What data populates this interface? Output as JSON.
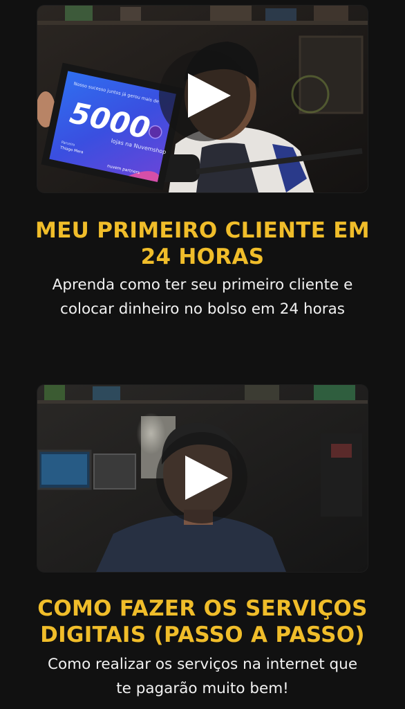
{
  "colors": {
    "background": "#111111",
    "title": "#f0bd2a",
    "description": "#f2f2f2"
  },
  "lessons": [
    {
      "title_line1": "MEU PRIMEIRO CLIENTE EM",
      "title_line2": "24 HORAS",
      "desc_line1": "Aprenda como ter seu primeiro cliente e",
      "desc_line2": "colocar dinheiro no bolso em 24 horas",
      "thumbnail": {
        "plaque_caption": "Nosso sucesso juntos já gerou mais de",
        "plaque_number": "5000",
        "plaque_subtitle": "lojas na Nuvemshop",
        "plaque_name_label": "Parceiro",
        "plaque_name": "Thiago Mera",
        "plaque_brand": "nuvem partners"
      },
      "play_icon": "play-icon"
    },
    {
      "title_line1": "COMO FAZER OS SERVIÇOS",
      "title_line2": "DIGITAIS (PASSO A PASSO)",
      "desc_line1": "Como realizar os serviços na internet que",
      "desc_line2": "te pagarão muito bem!",
      "play_icon": "play-icon"
    }
  ]
}
